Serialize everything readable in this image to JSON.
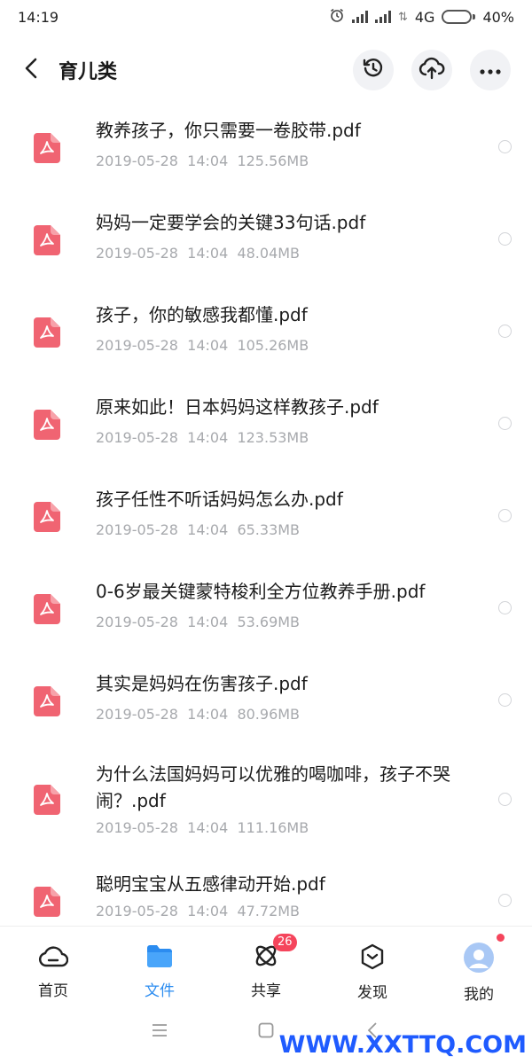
{
  "status": {
    "time": "14:19",
    "network": "4G",
    "battery": "40%",
    "battery_level": 0.4
  },
  "header": {
    "title": "育儿类",
    "icons": [
      "back-icon",
      "history-icon",
      "cloud-upload-icon",
      "more-icon"
    ]
  },
  "files": [
    {
      "name": "教养孩子，你只需要一卷胶带.pdf",
      "date": "2019-05-28",
      "time": "14:04",
      "size": "125.56MB"
    },
    {
      "name": "妈妈一定要学会的关键33句话.pdf",
      "date": "2019-05-28",
      "time": "14:04",
      "size": "48.04MB"
    },
    {
      "name": "孩子，你的敏感我都懂.pdf",
      "date": "2019-05-28",
      "time": "14:04",
      "size": "105.26MB"
    },
    {
      "name": "原来如此！日本妈妈这样教孩子.pdf",
      "date": "2019-05-28",
      "time": "14:04",
      "size": "123.53MB"
    },
    {
      "name": "孩子任性不听话妈妈怎么办.pdf",
      "date": "2019-05-28",
      "time": "14:04",
      "size": "65.33MB"
    },
    {
      "name": "0-6岁最关键蒙特梭利全方位教养手册.pdf",
      "date": "2019-05-28",
      "time": "14:04",
      "size": "53.69MB"
    },
    {
      "name": "其实是妈妈在伤害孩子.pdf",
      "date": "2019-05-28",
      "time": "14:04",
      "size": "80.96MB"
    },
    {
      "name": "为什么法国妈妈可以优雅的喝咖啡，孩子不哭闹？.pdf",
      "date": "2019-05-28",
      "time": "14:04",
      "size": "111.16MB"
    },
    {
      "name": "聪明宝宝从五感律动开始.pdf",
      "date": "2019-05-28",
      "time": "14:04",
      "size": "47.72MB"
    }
  ],
  "nav": {
    "home": "首页",
    "files": "文件",
    "share": "共享",
    "discover": "发现",
    "mine": "我的",
    "share_badge": "26",
    "active": "files"
  },
  "colors": {
    "accent": "#2b8cf0",
    "pdf": "#f06472",
    "badge": "#f5455c"
  },
  "watermark": "WWW.XXTTQ.COM"
}
